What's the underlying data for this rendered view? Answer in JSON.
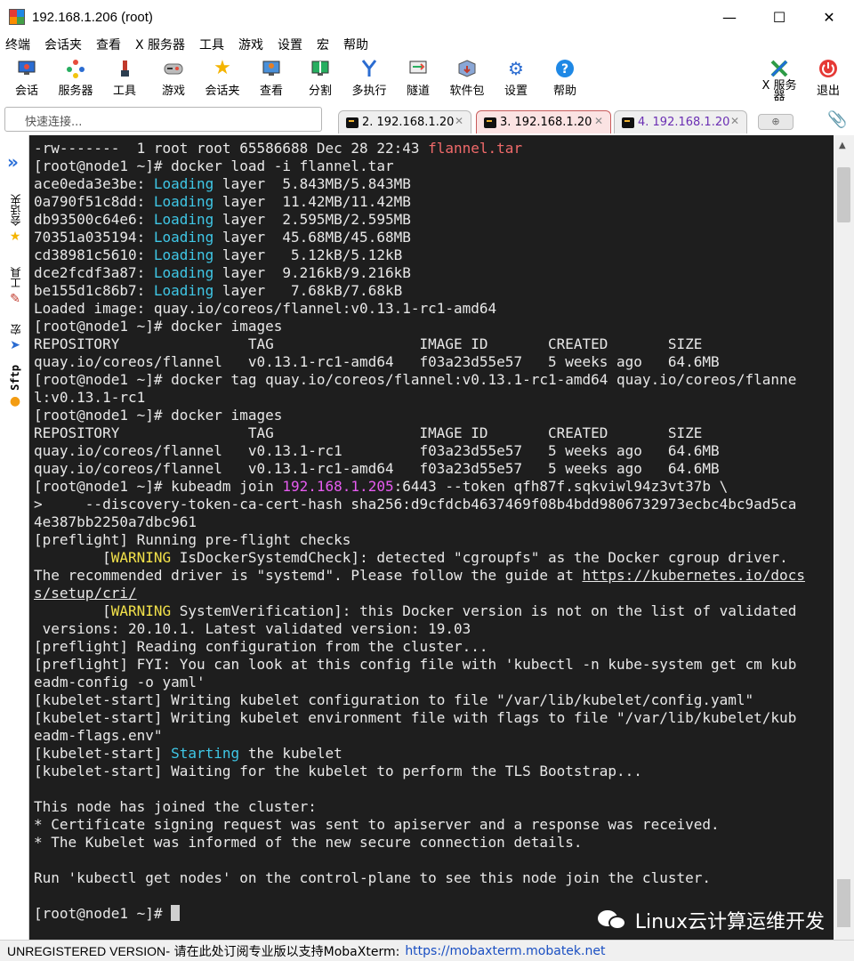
{
  "window": {
    "title": "192.168.1.206 (root)",
    "controls": [
      "—",
      "☐",
      "✕"
    ]
  },
  "menu": [
    "终端",
    "会话夹",
    "查看",
    "X 服务器",
    "工具",
    "游戏",
    "设置",
    "宏",
    "帮助"
  ],
  "toolbar": {
    "items": [
      {
        "label": "会话",
        "icon": "session-icon"
      },
      {
        "label": "服务器",
        "icon": "servers-icon"
      },
      {
        "label": "工具",
        "icon": "tools-icon"
      },
      {
        "label": "游戏",
        "icon": "games-icon"
      },
      {
        "label": "会话夹",
        "icon": "star-icon"
      },
      {
        "label": "查看",
        "icon": "view-icon"
      },
      {
        "label": "分割",
        "icon": "split-icon"
      },
      {
        "label": "多执行",
        "icon": "multiexec-icon"
      },
      {
        "label": "隧道",
        "icon": "tunnel-icon"
      },
      {
        "label": "软件包",
        "icon": "packages-icon"
      },
      {
        "label": "设置",
        "icon": "settings-icon"
      },
      {
        "label": "帮助",
        "icon": "help-icon"
      }
    ],
    "xserver": {
      "line1": "X 服务",
      "line2": "器"
    },
    "exit": "退出"
  },
  "quick_connect": {
    "placeholder": "快速连接..."
  },
  "tabs": [
    {
      "label": "2. 192.168.1.20",
      "active": false
    },
    {
      "label": "3. 192.168.1.20",
      "active": true
    },
    {
      "label": "4. 192.168.1.20",
      "active": false
    }
  ],
  "side_tabs": [
    "会话夹",
    "工具",
    "宏",
    "Sftp"
  ],
  "terminal": {
    "lines": [
      {
        "t": "-rw-------  1 root root 65586688 Dec 28 22:43 ",
        "red": "flannel.tar"
      },
      {
        "t": "[root@node1 ~]# docker load -i flannel.tar"
      },
      {
        "a": "ace0eda3e3be: ",
        "cyan": "Loading",
        "b": " layer  5.843MB/5.843MB"
      },
      {
        "a": "0a790f51c8dd: ",
        "cyan": "Loading",
        "b": " layer  11.42MB/11.42MB"
      },
      {
        "a": "db93500c64e6: ",
        "cyan": "Loading",
        "b": " layer  2.595MB/2.595MB"
      },
      {
        "a": "70351a035194: ",
        "cyan": "Loading",
        "b": " layer  45.68MB/45.68MB"
      },
      {
        "a": "cd38981c5610: ",
        "cyan": "Loading",
        "b": " layer   5.12kB/5.12kB"
      },
      {
        "a": "dce2fcdf3a87: ",
        "cyan": "Loading",
        "b": " layer  9.216kB/9.216kB"
      },
      {
        "a": "be155d1c86b7: ",
        "cyan": "Loading",
        "b": " layer   7.68kB/7.68kB"
      },
      {
        "t": "Loaded image: quay.io/coreos/flannel:v0.13.1-rc1-amd64"
      },
      {
        "t": "[root@node1 ~]# docker images"
      },
      {
        "t": "REPOSITORY               TAG                 IMAGE ID       CREATED       SIZE"
      },
      {
        "t": "quay.io/coreos/flannel   v0.13.1-rc1-amd64   f03a23d55e57   5 weeks ago   64.6MB"
      },
      {
        "t": "[root@node1 ~]# docker tag quay.io/coreos/flannel:v0.13.1-rc1-amd64 quay.io/coreos/flanne"
      },
      {
        "t": "l:v0.13.1-rc1"
      },
      {
        "t": "[root@node1 ~]# docker images"
      },
      {
        "t": "REPOSITORY               TAG                 IMAGE ID       CREATED       SIZE"
      },
      {
        "t": "quay.io/coreos/flannel   v0.13.1-rc1         f03a23d55e57   5 weeks ago   64.6MB"
      },
      {
        "t": "quay.io/coreos/flannel   v0.13.1-rc1-amd64   f03a23d55e57   5 weeks ago   64.6MB"
      },
      {
        "a": "[root@node1 ~]# kubeadm join ",
        "mag": "192.168.1.205",
        "b": ":6443 --token qfh87f.sqkviwl94z3vt37b \\"
      },
      {
        "t": ">     --discovery-token-ca-cert-hash sha256:d9cfdcb4637469f08b4bdd9806732973ecbc4bc9ad5ca"
      },
      {
        "t": "4e387bb2250a7dbc961"
      },
      {
        "t": "[preflight] Running pre-flight checks"
      },
      {
        "a": "        [",
        "yellow": "WARNING",
        "b": " IsDockerSystemdCheck]: detected \"cgroupfs\" as the Docker cgroup driver."
      },
      {
        "a": "The recommended driver is \"systemd\". Please follow the guide at ",
        "link": "https://kubernetes.io/docs"
      },
      {
        "link": "s/setup/cri/"
      },
      {
        "a": "        [",
        "yellow": "WARNING",
        "b": " SystemVerification]: this Docker version is not on the list of validated"
      },
      {
        "t": " versions: 20.10.1. Latest validated version: 19.03"
      },
      {
        "t": "[preflight] Reading configuration from the cluster..."
      },
      {
        "t": "[preflight] FYI: You can look at this config file with 'kubectl -n kube-system get cm kub"
      },
      {
        "t": "eadm-config -o yaml'"
      },
      {
        "t": "[kubelet-start] Writing kubelet configuration to file \"/var/lib/kubelet/config.yaml\""
      },
      {
        "t": "[kubelet-start] Writing kubelet environment file with flags to file \"/var/lib/kubelet/kub"
      },
      {
        "t": "eadm-flags.env\""
      },
      {
        "a": "[kubelet-start] ",
        "cyan": "Starting",
        "b": " the kubelet"
      },
      {
        "t": "[kubelet-start] Waiting for the kubelet to perform the TLS Bootstrap..."
      },
      {
        "t": ""
      },
      {
        "t": "This node has joined the cluster:"
      },
      {
        "t": "* Certificate signing request was sent to apiserver and a response was received."
      },
      {
        "t": "* The Kubelet was informed of the new secure connection details."
      },
      {
        "t": ""
      },
      {
        "t": "Run 'kubectl get nodes' on the control-plane to see this node join the cluster."
      },
      {
        "t": ""
      },
      {
        "prompt": "[root@node1 ~]# "
      }
    ]
  },
  "watermark": "Linux云计算运维开发",
  "statusbar": {
    "reg": "UNREGISTERED VERSION",
    "text": " -  请在此处订阅专业版以支持MobaXterm:",
    "url": "https://mobaxterm.mobatek.net"
  },
  "colors": {
    "terminal_bg": "#1e1e1e",
    "red": "#f06a6a",
    "cyan": "#3fc7e6",
    "magenta": "#e65cf0",
    "yellow": "#f3e24a",
    "active_tab": "#fbe3e3"
  }
}
